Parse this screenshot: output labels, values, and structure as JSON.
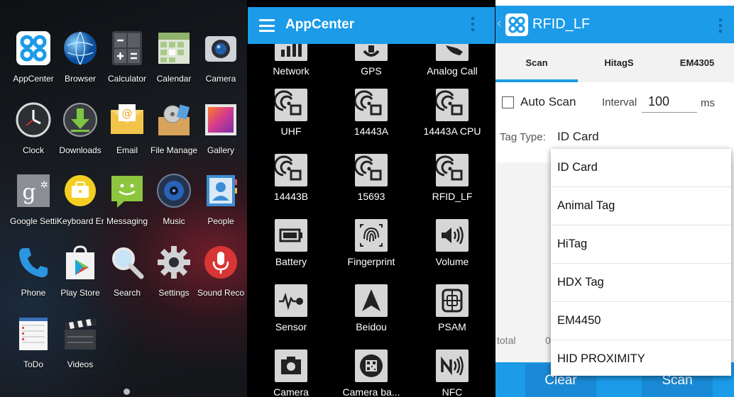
{
  "launcher": {
    "apps": [
      {
        "label": "AppCenter",
        "icon": "appcenter-icon"
      },
      {
        "label": "Browser",
        "icon": "globe-icon"
      },
      {
        "label": "Calculator",
        "icon": "calculator-icon"
      },
      {
        "label": "Calendar",
        "icon": "calendar-icon"
      },
      {
        "label": "Camera",
        "icon": "camera-icon"
      },
      {
        "label": "Clock",
        "icon": "clock-icon"
      },
      {
        "label": "Downloads",
        "icon": "download-icon"
      },
      {
        "label": "Email",
        "icon": "email-icon"
      },
      {
        "label": "File Manage",
        "icon": "file-manager-icon"
      },
      {
        "label": "Gallery",
        "icon": "gallery-icon"
      },
      {
        "label": "Google Setti",
        "icon": "google-settings-icon"
      },
      {
        "label": "Keyboard Er",
        "icon": "keyboard-icon"
      },
      {
        "label": "Messaging",
        "icon": "messaging-icon"
      },
      {
        "label": "Music",
        "icon": "music-icon"
      },
      {
        "label": "People",
        "icon": "people-icon"
      },
      {
        "label": "Phone",
        "icon": "phone-icon"
      },
      {
        "label": "Play Store",
        "icon": "play-store-icon"
      },
      {
        "label": "Search",
        "icon": "search-icon"
      },
      {
        "label": "Settings",
        "icon": "settings-icon"
      },
      {
        "label": "Sound Reco",
        "icon": "microphone-icon"
      },
      {
        "label": "ToDo",
        "icon": "todo-icon"
      },
      {
        "label": "Videos",
        "icon": "clapperboard-icon"
      }
    ]
  },
  "appcenter": {
    "title": "AppCenter",
    "tiles": [
      {
        "label": "Network",
        "icon": "signal-icon"
      },
      {
        "label": "GPS",
        "icon": "gps-icon"
      },
      {
        "label": "Analog Call",
        "icon": "phone-icon"
      },
      {
        "label": "UHF",
        "icon": "rfid-icon"
      },
      {
        "label": "14443A",
        "icon": "rfid-icon"
      },
      {
        "label": "14443A CPU",
        "icon": "rfid-icon"
      },
      {
        "label": "14443B",
        "icon": "rfid-icon"
      },
      {
        "label": "15693",
        "icon": "rfid-icon"
      },
      {
        "label": "RFID_LF",
        "icon": "rfid-icon"
      },
      {
        "label": "Battery",
        "icon": "battery-icon"
      },
      {
        "label": "Fingerprint",
        "icon": "fingerprint-icon"
      },
      {
        "label": "Volume",
        "icon": "volume-icon"
      },
      {
        "label": "Sensor",
        "icon": "sensor-icon"
      },
      {
        "label": "Beidou",
        "icon": "navigation-arrow-icon"
      },
      {
        "label": "PSAM",
        "icon": "sim-card-icon"
      },
      {
        "label": "Camera",
        "icon": "camera-icon"
      },
      {
        "label": "Camera ba...",
        "icon": "barcode-camera-icon"
      },
      {
        "label": "NFC",
        "icon": "nfc-icon"
      }
    ]
  },
  "rfid": {
    "title": "RFID_LF",
    "tabs": [
      "Scan",
      "HitagS",
      "EM4305"
    ],
    "active_tab": "Scan",
    "auto_scan_label": "Auto Scan",
    "interval_label": "Interval",
    "interval_value": "100",
    "interval_unit": "ms",
    "tag_type_label": "Tag Type:",
    "tag_type_value": "ID Card",
    "total_label": "total",
    "total_value": "0",
    "clear_label": "Clear",
    "scan_label": "Scan",
    "options": [
      "ID Card",
      "Animal Tag",
      "HiTag",
      "HDX Tag",
      "EM4450",
      "HID PROXIMITY"
    ]
  },
  "colors": {
    "accent": "#1b9be8",
    "tile_bg": "#d6d6d6"
  }
}
